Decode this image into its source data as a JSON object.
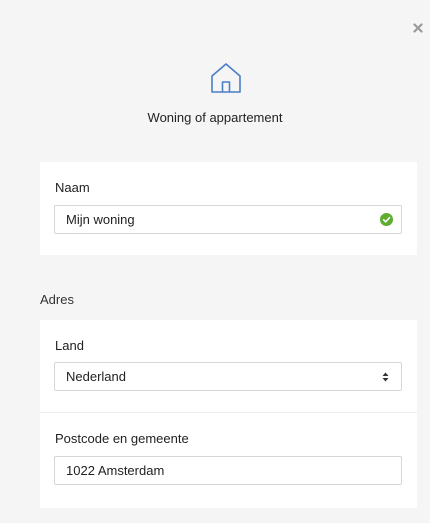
{
  "header": {
    "title": "Woning of appartement",
    "icon": "home-icon"
  },
  "close": {
    "icon": "close-icon"
  },
  "naam": {
    "label": "Naam",
    "value": "Mijn woning",
    "valid_icon": "check-circle-icon",
    "valid_color": "#5fad2f"
  },
  "adres": {
    "section_label": "Adres",
    "land": {
      "label": "Land",
      "value": "Nederland"
    },
    "postcode": {
      "label": "Postcode en gemeente",
      "value": "1022 Amsterdam"
    }
  },
  "colors": {
    "accent": "#4a7fc7",
    "background": "#f5f5f5",
    "card": "#ffffff"
  }
}
